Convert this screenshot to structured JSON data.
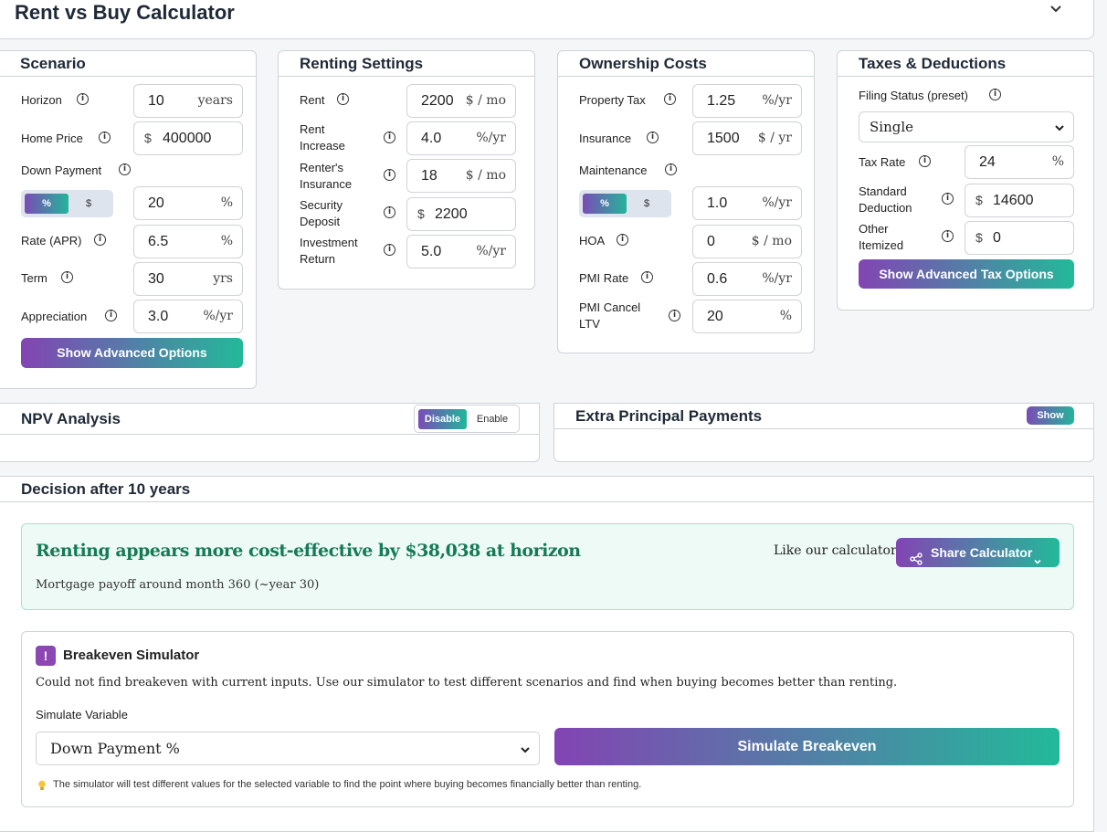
{
  "header": {
    "title": "Rent vs Buy Calculator"
  },
  "scenario": {
    "title": "Scenario",
    "horizon": {
      "label": "Horizon",
      "value": "10",
      "unit": "years"
    },
    "home_price": {
      "label": "Home Price",
      "prefix": "$",
      "value": "400000"
    },
    "down_payment": {
      "label": "Down Payment",
      "toggle_on": "%",
      "toggle_off": "$",
      "value": "20",
      "unit": "%"
    },
    "rate": {
      "label": "Rate (APR)",
      "value": "6.5",
      "unit": "%"
    },
    "term": {
      "label": "Term",
      "value": "30",
      "unit": "yrs"
    },
    "appreciation": {
      "label": "Appreciation",
      "value": "3.0",
      "unit": "%/yr"
    },
    "advanced_button": "Show Advanced Options"
  },
  "renting": {
    "title": "Renting Settings",
    "rent": {
      "label": "Rent",
      "value": "2200",
      "unit": "$ / mo"
    },
    "rent_increase": {
      "label": "Rent Increase",
      "value": "4.0",
      "unit": "%/yr"
    },
    "renters_insurance": {
      "label": "Renter's Insurance",
      "value": "18",
      "unit": "$ / mo"
    },
    "security_deposit": {
      "label": "Security Deposit",
      "prefix": "$",
      "value": "2200"
    },
    "investment_return": {
      "label": "Investment Return",
      "value": "5.0",
      "unit": "%/yr"
    }
  },
  "ownership": {
    "title": "Ownership Costs",
    "property_tax": {
      "label": "Property Tax",
      "value": "1.25",
      "unit": "%/yr"
    },
    "insurance": {
      "label": "Insurance",
      "value": "1500",
      "unit": "$ / yr"
    },
    "maintenance": {
      "label": "Maintenance",
      "toggle_on": "%",
      "toggle_off": "$",
      "value": "1.0",
      "unit": "%/yr"
    },
    "hoa": {
      "label": "HOA",
      "value": "0",
      "unit": "$ / mo"
    },
    "pmi_rate": {
      "label": "PMI Rate",
      "value": "0.6",
      "unit": "%/yr"
    },
    "pmi_cancel": {
      "label": "PMI Cancel LTV",
      "value": "20",
      "unit": "%"
    }
  },
  "taxes": {
    "title": "Taxes & Deductions",
    "filing_label": "Filing Status (preset)",
    "filing_value": "Single",
    "tax_rate": {
      "label": "Tax Rate",
      "value": "24",
      "unit": "%"
    },
    "standard_deduction": {
      "label": "Standard Deduction",
      "prefix": "$",
      "value": "14600"
    },
    "other_itemized": {
      "label": "Other Itemized",
      "prefix": "$",
      "value": "0"
    },
    "advanced_button": "Show Advanced Tax Options"
  },
  "npv": {
    "title": "NPV Analysis",
    "disable": "Disable",
    "enable": "Enable"
  },
  "extra": {
    "title": "Extra Principal Payments",
    "show": "Show"
  },
  "decision": {
    "title": "Decision after 10 years",
    "headline": "Renting appears more cost-effective by $38,038 at horizon",
    "subtext": "Mortgage payoff around month 360 (~year 30)",
    "like_text": "Like our calculator?",
    "share_button": "Share Calculator"
  },
  "breakeven": {
    "badge": "!",
    "title": "Breakeven Simulator",
    "description": "Could not find breakeven with current inputs. Use our simulator to test different scenarios and find when buying becomes better than renting.",
    "sim_label": "Simulate Variable",
    "sim_value": "Down Payment %",
    "sim_button": "Simulate Breakeven",
    "hint": "The simulator will test different values for the selected variable to find the point where buying becomes financially better than renting."
  }
}
